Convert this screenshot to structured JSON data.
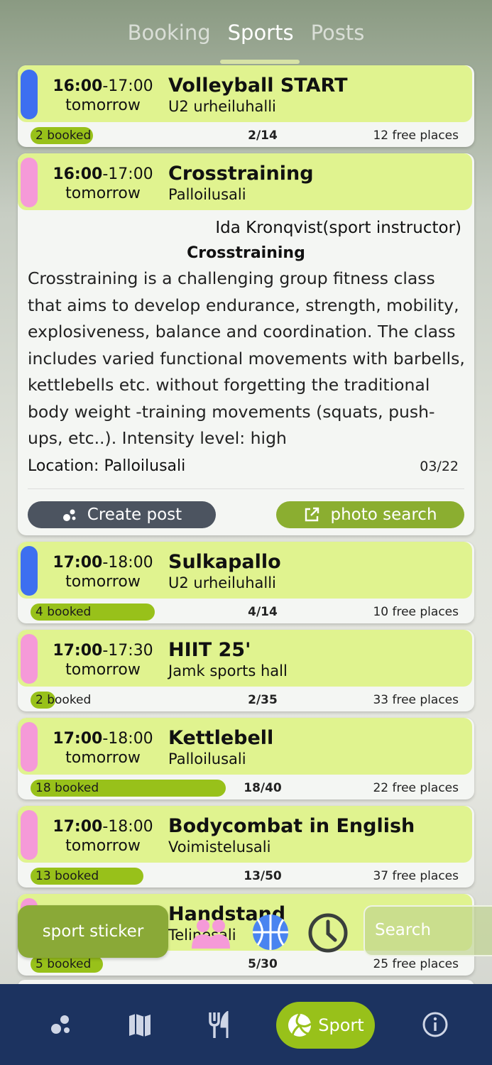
{
  "tabs": [
    {
      "label": "Booking"
    },
    {
      "label": "Sports"
    },
    {
      "label": "Posts"
    }
  ],
  "classes": [
    {
      "start": "16:00",
      "end": "-17:00",
      "day": "tomorrow",
      "title": "Volleyball START",
      "location": "U2 urheiluhalli",
      "booked": "2 booked",
      "ratio": "2/14",
      "free": "12 free places",
      "marker_color": "#3d6ff0",
      "fill": 0.143
    },
    {
      "start": "16:00",
      "end": "-17:00",
      "day": "tomorrow",
      "title": "Crosstraining",
      "location": "Palloilusali",
      "marker_color": "#f59ad8"
    },
    {
      "start": "17:00",
      "end": "-18:00",
      "day": "tomorrow",
      "title": "Sulkapallo",
      "location": "U2 urheiluhalli",
      "booked": "4 booked",
      "ratio": "4/14",
      "free": "10 free places",
      "marker_color": "#3d6ff0",
      "fill": 0.286
    },
    {
      "start": "17:00",
      "end": "-17:30",
      "day": "tomorrow",
      "title": "HIIT 25'",
      "location": "Jamk sports hall",
      "booked": "2 booked",
      "ratio": "2/35",
      "free": "33 free places",
      "marker_color": "#f59ad8",
      "fill": 0.057
    },
    {
      "start": "17:00",
      "end": "-18:00",
      "day": "tomorrow",
      "title": "Kettlebell",
      "location": "Palloilusali",
      "booked": "18 booked",
      "ratio": "18/40",
      "free": "22 free places",
      "marker_color": "#f59ad8",
      "fill": 0.45
    },
    {
      "start": "17:00",
      "end": "-18:00",
      "day": "tomorrow",
      "title": "Bodycombat in English",
      "location": "Voimistelusali",
      "booked": "13 booked",
      "ratio": "13/50",
      "free": "37 free places",
      "marker_color": "#f59ad8",
      "fill": 0.26
    },
    {
      "title": "Handstand",
      "location": "Telinesali",
      "booked": "5 booked",
      "ratio": "5/30",
      "free": "25 free places",
      "marker_color": "#f59ad8",
      "fill": 0.167
    }
  ],
  "expanded": {
    "instructor": "Ida Kronqvist(sport instructor)",
    "heading": "Crosstraining",
    "description": "Crosstraining is a challenging group fitness class that aims to develop endurance, strength, mobility, explosiveness, balance and coordination. The class includes varied functional movements with barbells, kettlebells etc. without forgetting the traditional body weight -training movements (squats, push-ups, etc..). Intensity level: high",
    "location_line": "Location: Palloilusali",
    "date": "03/22",
    "create_post": "Create post",
    "photo_search": "photo search"
  },
  "floating": {
    "sport_sticker": "sport sticker",
    "search_placeholder": "Search"
  },
  "bottom_nav": {
    "sport_label": "Sport"
  },
  "colors": {
    "accent": "#98c11a",
    "card_header": "#e0f38f",
    "nav_bg": "#1c3360"
  }
}
